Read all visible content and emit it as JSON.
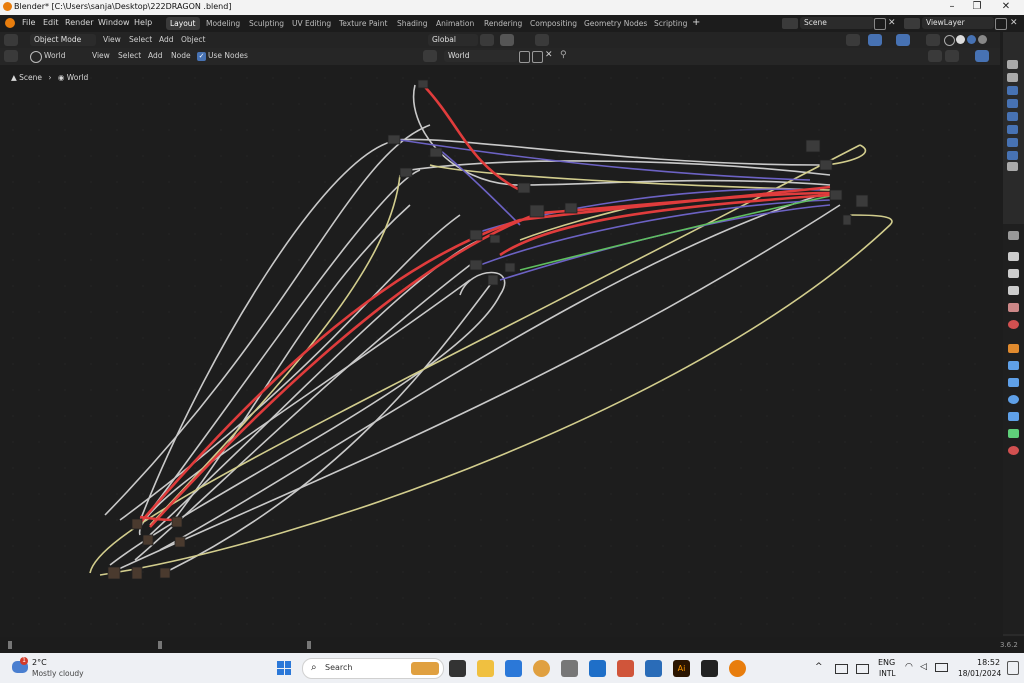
{
  "window": {
    "title": "Blender* [C:\\Users\\sanja\\Desktop\\222DRAGON .blend]"
  },
  "topbar": {
    "menus": [
      "File",
      "Edit",
      "Render",
      "Window",
      "Help"
    ],
    "workspaces": [
      "Layout",
      "Modeling",
      "Sculpting",
      "UV Editing",
      "Texture Paint",
      "Shading",
      "Animation",
      "Rendering",
      "Compositing",
      "Geometry Nodes",
      "Scripting"
    ],
    "add_tab": "+",
    "scene": "Scene",
    "view_layer": "ViewLayer"
  },
  "header2": {
    "mode": "Object Mode",
    "menus": [
      "View",
      "Select",
      "Add",
      "Object"
    ],
    "transform": "Global"
  },
  "header3": {
    "world_type": "World",
    "menus": [
      "View",
      "Select",
      "Add",
      "Node"
    ],
    "use_nodes_label": "Use Nodes",
    "world_name": "World"
  },
  "breadcrumb": {
    "scene": "Scene",
    "world": "World"
  },
  "status": {
    "version": "3.6.2"
  },
  "taskbar": {
    "weather_temp": "2°C",
    "weather_desc": "Mostly cloudy",
    "weather_badge": "1",
    "search_placeholder": "Search",
    "lang_top": "ENG",
    "lang_bottom": "INTL",
    "time": "18:52",
    "date": "18/01/2024"
  },
  "colors": {
    "accent": "#4772b3",
    "blender_orange": "#e87d0d",
    "wire_red": "#e03c3c",
    "wire_grey": "#c7c7c7",
    "wire_yellow": "#cfc98a",
    "wire_purple": "#6a5fc0",
    "wire_green": "#5fbf5f"
  }
}
